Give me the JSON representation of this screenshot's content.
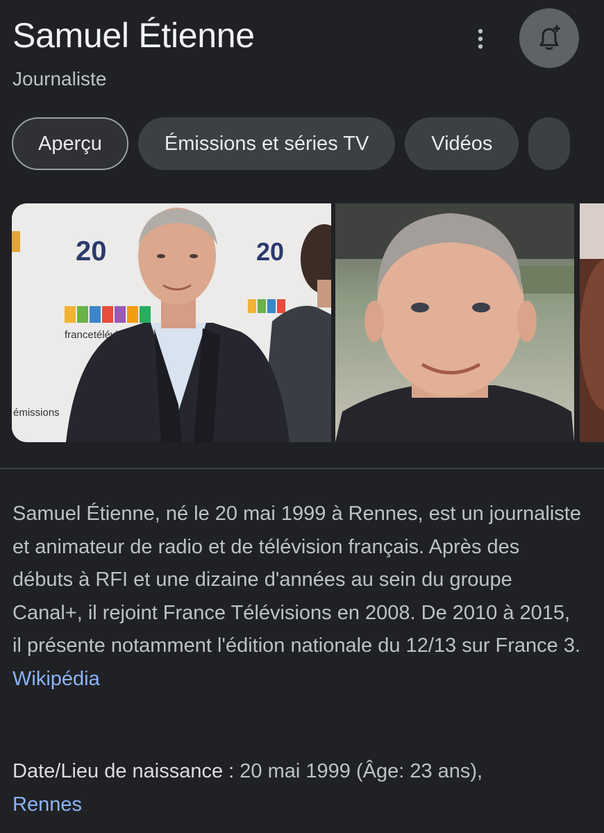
{
  "header": {
    "title": "Samuel Étienne",
    "subtitle": "Journaliste",
    "more_icon": "more-vertical-icon",
    "follow_icon": "bell-plus-icon"
  },
  "tabs": [
    {
      "label": "Aperçu",
      "active": true
    },
    {
      "label": "Émissions et séries TV",
      "active": false
    },
    {
      "label": "Vidéos",
      "active": false
    }
  ],
  "images": {
    "photo1": {
      "backdrop_text": "20",
      "backdrop_brand": "francetélévisions",
      "backdrop_text2": "émissions"
    },
    "photo2": {},
    "photo3": {}
  },
  "description": {
    "text": "Samuel Étienne, né le 20 mai 1999 à Rennes, est un journaliste et animateur de radio et de télévision français. Après des débuts à RFI et une dizaine d'années au sein du groupe Canal+, il rejoint France Télévisions en 2008. De 2010 à 2015, il présente notamment l'édition nationale du 12/13 sur France 3.",
    "source_link": "Wikipédia"
  },
  "facts": {
    "birth_label": "Date/Lieu de naissance",
    "birth_value": "20 mai 1999 (Âge: 23 ans),",
    "birth_place": "Rennes"
  },
  "colors": {
    "background": "#202124",
    "link": "#8ab4f8",
    "chip": "#3c4043"
  }
}
